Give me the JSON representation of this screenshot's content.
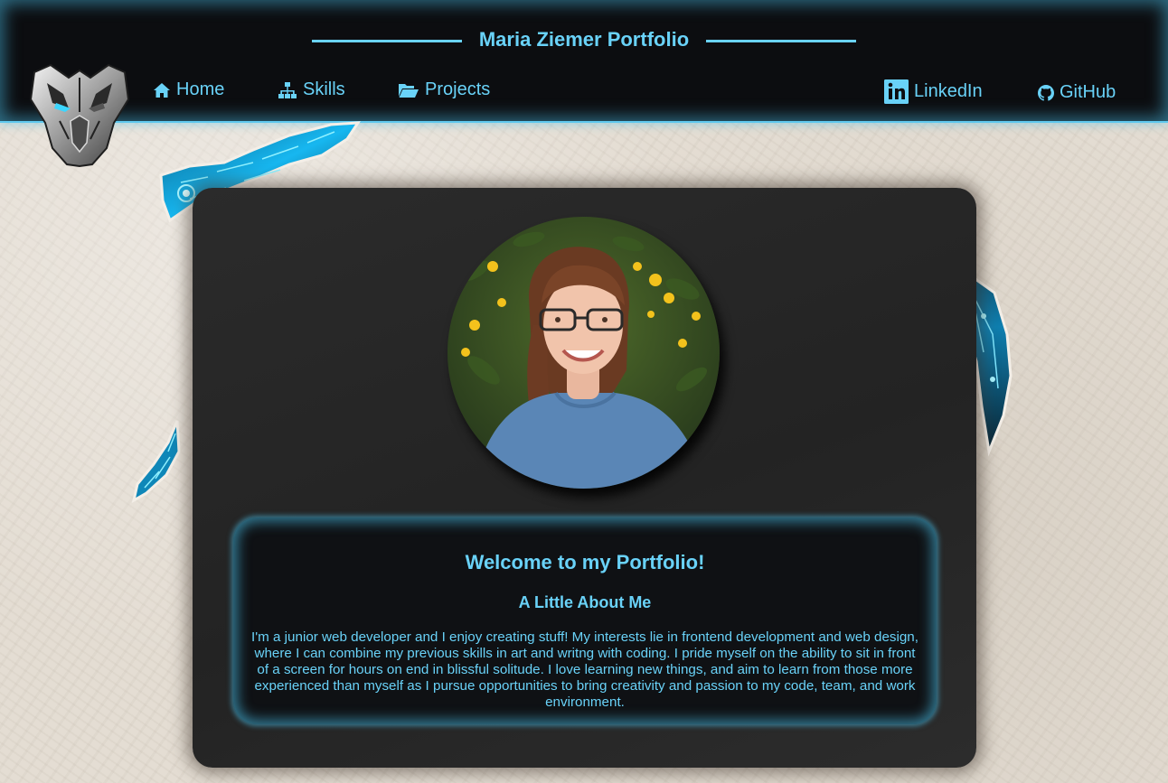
{
  "header": {
    "title": "Maria Ziemer Portfolio",
    "nav": [
      {
        "label": "Home",
        "icon": "home-icon"
      },
      {
        "label": "Skills",
        "icon": "sitemap-icon"
      },
      {
        "label": "Projects",
        "icon": "folder-open-icon"
      }
    ],
    "social": [
      {
        "label": "LinkedIn",
        "icon": "linkedin-icon"
      },
      {
        "label": "GitHub",
        "icon": "github-icon"
      }
    ],
    "logo_icon": "robot-mask-logo"
  },
  "main": {
    "profile_photo": "profile-photo",
    "welcome": "Welcome to my Portfolio!",
    "about_heading": "A Little About Me",
    "about_text": "I'm a junior web developer and I enjoy creating stuff! My interests lie in frontend development and web design, where I can combine my previous skills in art and writng with coding. I pride myself on the ability to sit in front of a screen for hours on end in blissful solitude. I love learning new things, and aim to learn from those more experienced than myself as I pursue opportunities to bring creativity and passion to my code, team, and work environment."
  },
  "colors": {
    "accent": "#69d2f8",
    "header_bg": "#0c0d10",
    "card_bg": "#262626",
    "paper_bg": "#e4ddd3"
  }
}
